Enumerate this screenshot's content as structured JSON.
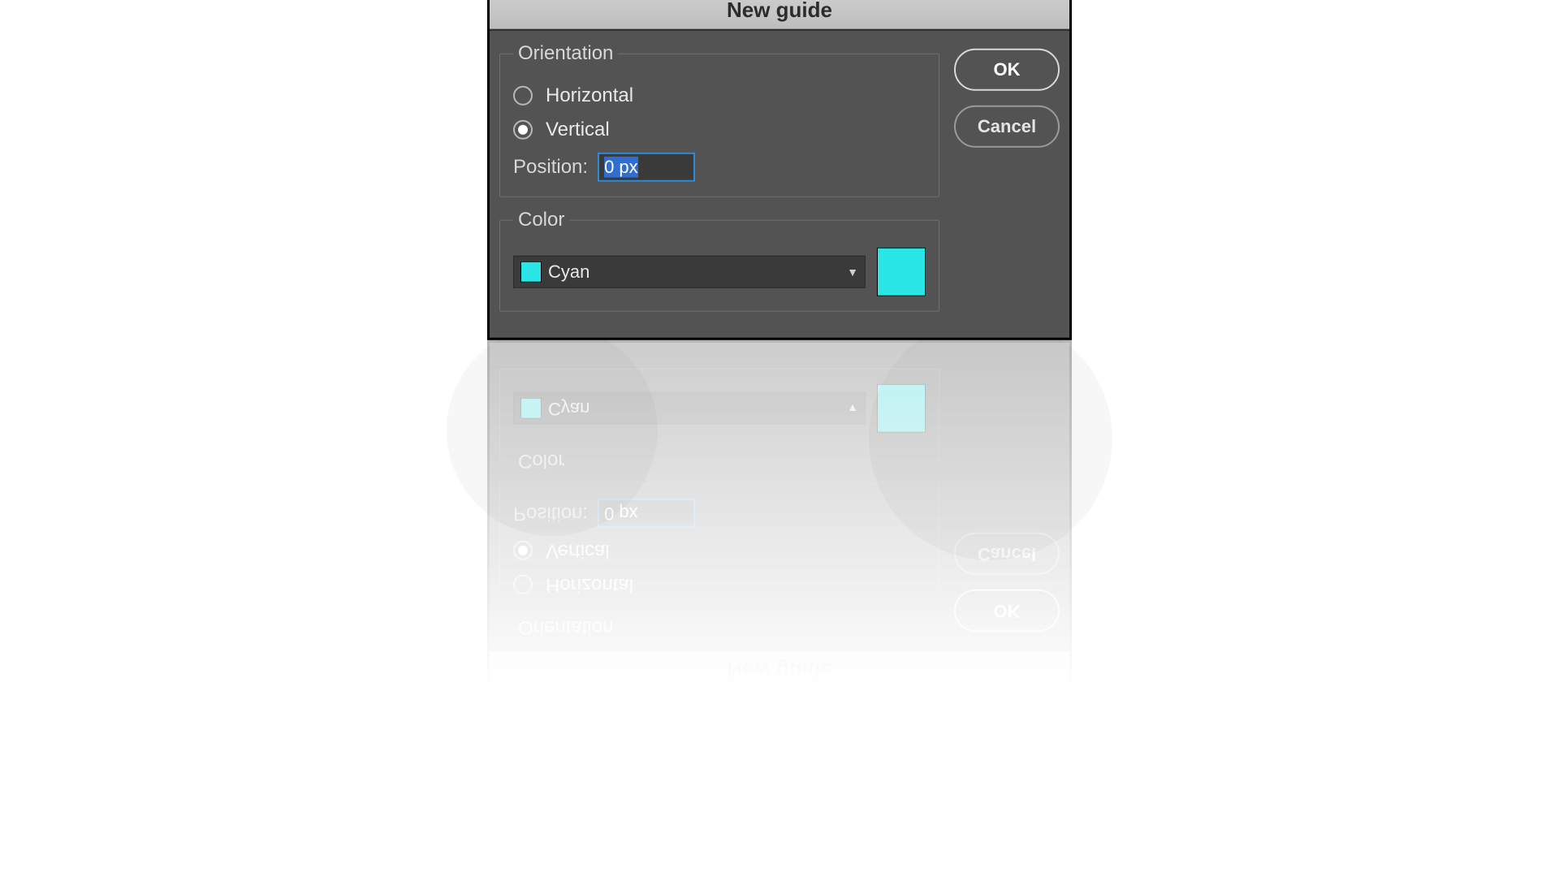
{
  "dialog": {
    "title": "New guide",
    "groups": {
      "orientation": {
        "legend": "Orientation",
        "options": {
          "horizontal": "Horizontal",
          "vertical": "Vertical"
        },
        "selected": "vertical",
        "position_label": "Position:",
        "position_value": "0 px"
      },
      "color": {
        "legend": "Color",
        "selected_label": "Cyan",
        "swatch_hex": "#2be6e6"
      }
    },
    "buttons": {
      "ok": "OK",
      "cancel": "Cancel"
    }
  }
}
